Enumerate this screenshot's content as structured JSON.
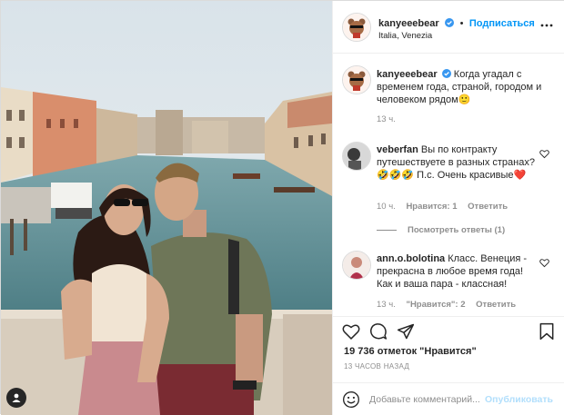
{
  "post": {
    "username": "kanyeeebear",
    "follow_label": "Подписаться",
    "follow_separator": "•",
    "location": "Italia, Venezia",
    "verified_icon": "verified-badge-icon",
    "more_icon": "more-options-icon"
  },
  "caption": {
    "username": "kanyeeebear",
    "text": "Когда угадал с временем года, страной, городом и человеком рядом🙂",
    "time": "13 ч."
  },
  "comments": [
    {
      "username": "veberfan",
      "text": "Вы по контракту путешествуете в разных странах?🤣🤣🤣 П.с. Очень красивые❤️",
      "time": "10 ч.",
      "likes": "Нравится: 1",
      "reply_label": "Ответить",
      "view_replies": "Посмотреть ответы (1)"
    },
    {
      "username": "ann.o.bolotina",
      "text": "Класс. Венеция - прекрасна в любое время года! Как и ваша пара - классная!",
      "time": "13 ч.",
      "likes": "\"Нравится\": 2",
      "reply_label": "Ответить"
    }
  ],
  "actions": {
    "like_icon": "heart-icon",
    "comment_icon": "comment-icon",
    "share_icon": "share-icon",
    "save_icon": "bookmark-icon"
  },
  "likes_text": "19 736 отметок \"Нравится\"",
  "time_ago": "13 ЧАСОВ НАЗАД",
  "comment_box": {
    "placeholder": "Добавьте комментарий...",
    "publish_label": "Опубликовать"
  },
  "colors": {
    "accent": "#0095f6",
    "verified": "#3897f0",
    "text": "#262626",
    "muted": "#8e8e8e",
    "like_red": "#ed4956"
  }
}
